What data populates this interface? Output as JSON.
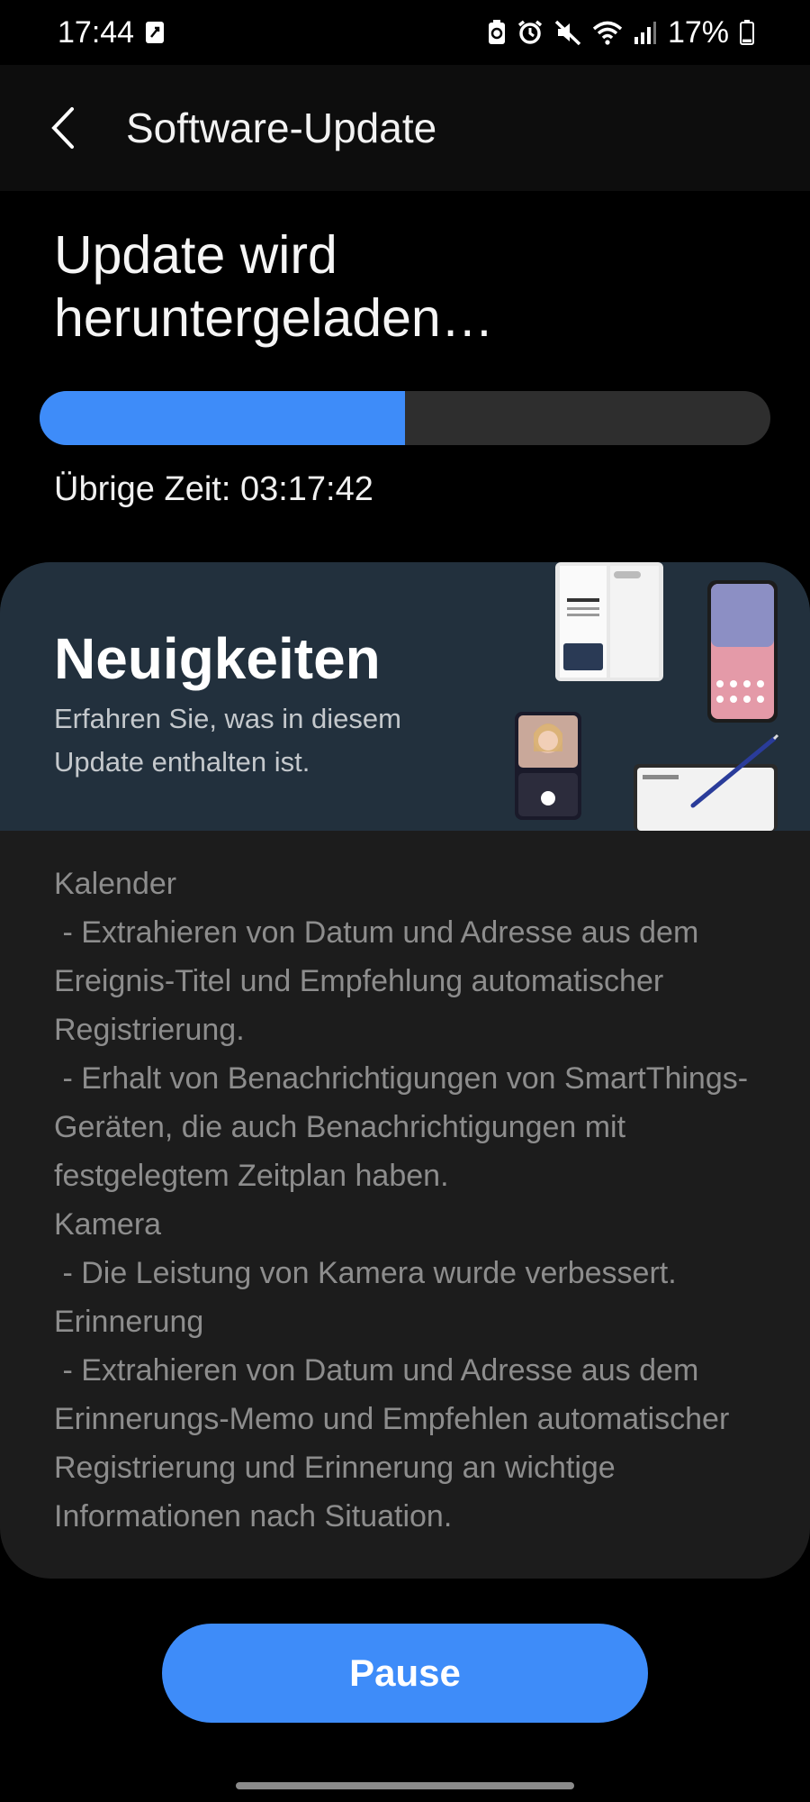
{
  "status_bar": {
    "time": "17:44",
    "battery_percent": "17%",
    "battery_level": 0.17,
    "icons": [
      "app-notification-icon",
      "battery-saver-icon",
      "alarm-icon",
      "mute-icon",
      "wifi-icon",
      "signal-icon",
      "battery-icon"
    ]
  },
  "header": {
    "back_icon": "chevron-left-icon",
    "title": "Software-Update"
  },
  "update": {
    "title": "Update wird heruntergeladen…",
    "progress": 0.5,
    "time_left_label": "Übrige Zeit:",
    "time_left_value": "03:17:42"
  },
  "news": {
    "heading": "Neuigkeiten",
    "subtitle": "Erfahren Sie, was in diesem Update enthalten ist.",
    "changelog": [
      "Kalender",
      " - Extrahieren von Datum und Adresse aus dem Ereignis-Titel und Empfehlung automatischer Registrierung.",
      " - Erhalt von Benachrichtigungen von SmartThings-Geräten, die auch Benachrichtigungen mit festgelegtem Zeitplan haben.",
      "Kamera",
      " - Die Leistung von Kamera wurde verbessert.",
      "Erinnerung",
      " - Extrahieren von Datum und Adresse aus dem Erinnerungs-Memo und Empfehlen automatischer Registrierung und Erinnerung an wichtige Informationen nach Situation."
    ]
  },
  "actions": {
    "pause_label": "Pause"
  },
  "colors": {
    "accent": "#3e8cf9",
    "banner": "#22303d",
    "card": "#1c1c1c"
  }
}
